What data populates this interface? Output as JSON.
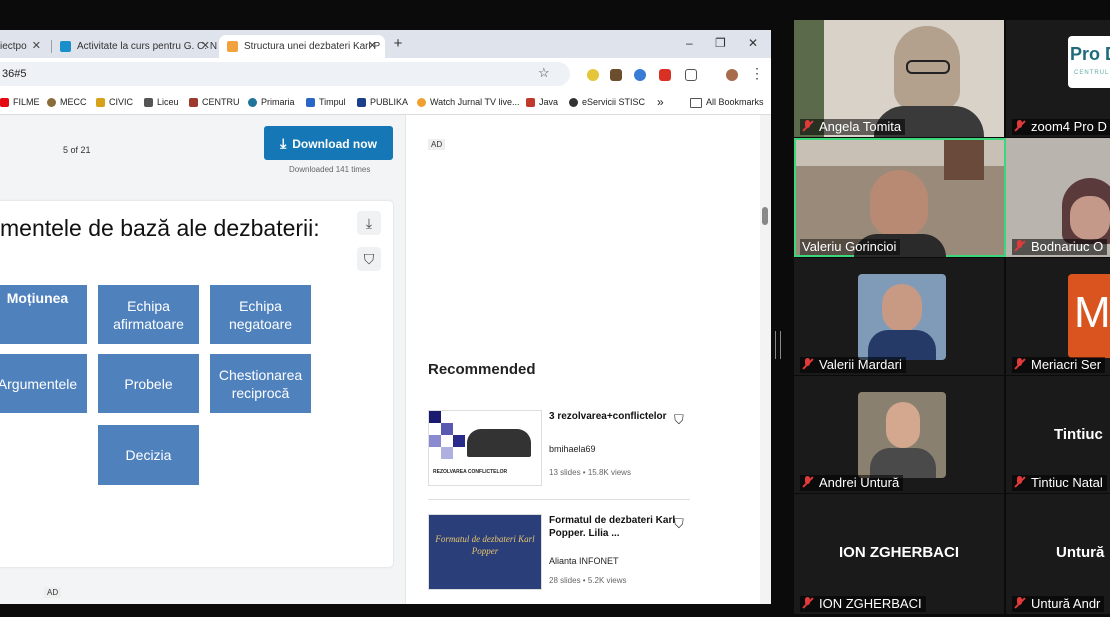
{
  "browser": {
    "tabs": [
      {
        "label": "iectpo"
      },
      {
        "label": "Activitate la curs pentru G. C. N"
      },
      {
        "label": "Structura unei dezbateri Karl P"
      }
    ],
    "tab_close": "✕",
    "new_tab": "+",
    "window_controls": {
      "minimize": "–",
      "maximize": "❐",
      "close": "✕"
    },
    "url": "36#5",
    "bookmarks": [
      "FILME",
      "MECC",
      "CIVIC",
      "Liceu",
      "CENTRU",
      "Primaria",
      "Timpul",
      "PUBLIKA",
      "Watch Jurnal TV live...",
      "Java",
      "eServicii STISC"
    ],
    "bookmarks_more": "»",
    "all_bookmarks": "All Bookmarks"
  },
  "viewer": {
    "page_count": "5 of 21",
    "download_label": "Download now",
    "download_count": "Downloaded 141 times",
    "ad_label": "AD",
    "slide": {
      "title": "mentele de bază ale dezbaterii:",
      "boxes": [
        "Moțiunea",
        "Echipa afirmatoare",
        "Echipa negatoare",
        "Argumentele",
        "Probele",
        "Chestionarea reciprocă",
        "Decizia"
      ]
    }
  },
  "sidebar": {
    "ad_label": "AD",
    "recommended_heading": "Recommended",
    "items": [
      {
        "title": "3 rezolvarea+conflictelor",
        "thumb_text": "REZOLVAREA CONFLICTELOR",
        "author": "bmihaela69",
        "meta": "13 slides • 15.8K views"
      },
      {
        "title": "Formatul de dezbateri Karl Popper. Lilia ...",
        "thumb_text": "Formatul de dezbateri Karl Popper",
        "author": "Alianta INFONET",
        "meta": "28 slides • 5.2K views"
      }
    ]
  },
  "gallery": {
    "participants": [
      {
        "name": "Angela Tomita"
      },
      {
        "name": "zoom4 Pro D"
      },
      {
        "name": "Valeriu Gorincioi"
      },
      {
        "name": "Bodnariuc O"
      },
      {
        "name": "Valerii Mardari"
      },
      {
        "name": "Meriacri Ser"
      },
      {
        "name": "Andrei Untură"
      },
      {
        "name": "Tintiuc Natal",
        "display": "Tintiuc"
      },
      {
        "name": "ION ZGHERBACI",
        "display": "ION ZGHERBACI"
      },
      {
        "name": "Untură Andr",
        "display": "Untură"
      }
    ],
    "logo_text": "Pro D",
    "logo_sub": "CENTRUL",
    "meriacri_initial": "M"
  },
  "colors": {
    "accent_blue": "#1577b5",
    "slide_box": "#4f81bd",
    "speaking_border": "#3ad87a",
    "muted_red": "#e03a3a"
  }
}
